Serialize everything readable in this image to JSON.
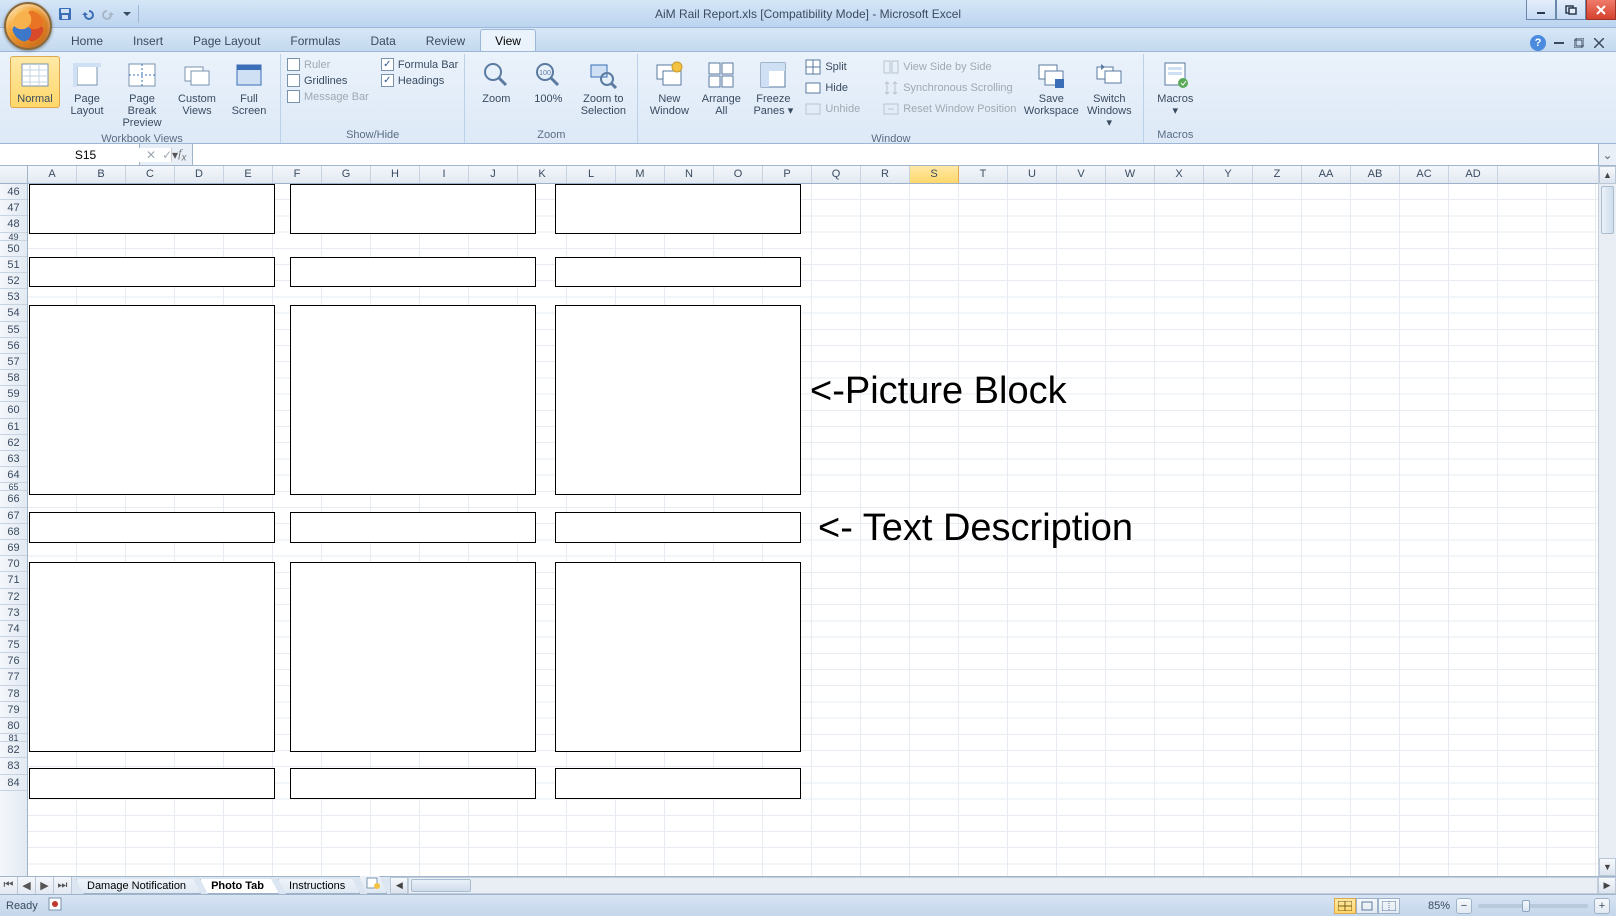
{
  "window": {
    "title": "AiM Rail Report.xls  [Compatibility Mode] - Microsoft Excel"
  },
  "ribbon": {
    "tabs": [
      "Home",
      "Insert",
      "Page Layout",
      "Formulas",
      "Data",
      "Review",
      "View"
    ],
    "active_tab": "View",
    "groups": {
      "workbook_views": {
        "label": "Workbook Views",
        "buttons": {
          "normal": "Normal",
          "page_layout": "Page Layout",
          "page_break": "Page Break Preview",
          "custom_views": "Custom Views",
          "full_screen": "Full Screen"
        }
      },
      "show_hide": {
        "label": "Show/Hide",
        "checks": {
          "ruler": {
            "label": "Ruler",
            "checked": false
          },
          "gridlines": {
            "label": "Gridlines",
            "checked": false
          },
          "message_bar": {
            "label": "Message Bar",
            "checked": false
          },
          "formula_bar": {
            "label": "Formula Bar",
            "checked": true
          },
          "headings": {
            "label": "Headings",
            "checked": true
          }
        }
      },
      "zoom": {
        "label": "Zoom",
        "buttons": {
          "zoom": "Zoom",
          "hundred": "100%",
          "to_selection": "Zoom to Selection"
        }
      },
      "window": {
        "label": "Window",
        "buttons": {
          "new_window": "New Window",
          "arrange_all": "Arrange All",
          "freeze_panes": "Freeze Panes",
          "split": "Split",
          "hide": "Hide",
          "unhide": "Unhide",
          "side_by_side": "View Side by Side",
          "sync_scroll": "Synchronous Scrolling",
          "reset_pos": "Reset Window Position",
          "save_ws": "Save Workspace",
          "switch": "Switch Windows"
        }
      },
      "macros": {
        "label": "Macros",
        "button": "Macros"
      }
    }
  },
  "namebox": {
    "value": "S15"
  },
  "grid": {
    "columns": [
      "A",
      "B",
      "C",
      "D",
      "E",
      "F",
      "G",
      "H",
      "I",
      "J",
      "K",
      "L",
      "M",
      "N",
      "O",
      "P",
      "Q",
      "R",
      "S",
      "T",
      "U",
      "V",
      "W",
      "X",
      "Y",
      "Z",
      "AA",
      "AB",
      "AC",
      "AD"
    ],
    "selected_col": "S",
    "rows_start": 46,
    "rows_end": 84,
    "short_rows": [
      49,
      65,
      81
    ]
  },
  "annotations": {
    "picture_block": "<-Picture Block",
    "text_description": "<- Text Description"
  },
  "sheets": {
    "nav": [
      "⏮",
      "◀",
      "▶",
      "⏭"
    ],
    "tabs": [
      {
        "name": "Damage Notification",
        "active": false
      },
      {
        "name": "Photo Tab",
        "active": true
      },
      {
        "name": "Instructions",
        "active": false
      }
    ]
  },
  "status": {
    "left": "Ready",
    "zoom_pct": "85%"
  }
}
